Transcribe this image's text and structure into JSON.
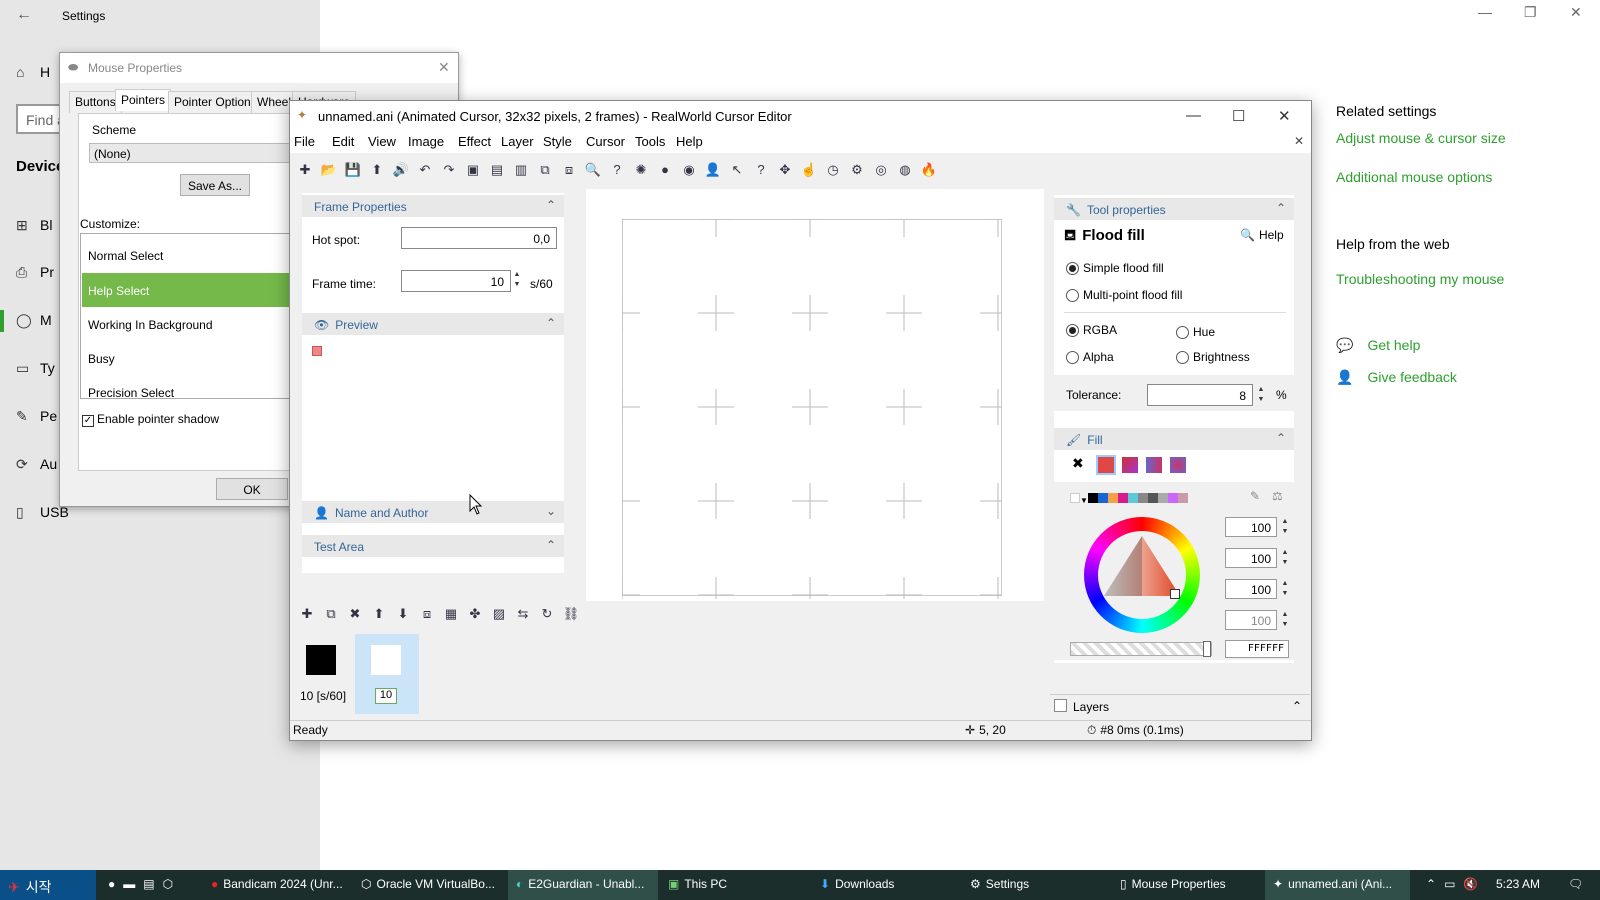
{
  "settings": {
    "title": "Settings",
    "search_placeholder": "Find a setting",
    "section": "Devices",
    "nav": [
      {
        "label": "Bluetooth & other devices",
        "short": "Bl"
      },
      {
        "label": "Printers & scanners",
        "short": "Pr"
      },
      {
        "label": "Mouse",
        "short": "M"
      },
      {
        "label": "Typing",
        "short": "Ty"
      },
      {
        "label": "Pen & Windows Ink",
        "short": "Pe"
      },
      {
        "label": "AutoPlay",
        "short": "Au"
      },
      {
        "label": "USB",
        "short": "USB"
      }
    ],
    "home_short": "H",
    "related_title": "Related settings",
    "link_size": "Adjust mouse & cursor size",
    "link_additional": "Additional mouse options",
    "help_title": "Help from the web",
    "link_trouble": "Troubleshooting my mouse",
    "get_help": "Get help",
    "give_feedback": "Give feedback"
  },
  "mouse_props": {
    "title": "Mouse Properties",
    "tabs": [
      "Buttons",
      "Pointers",
      "Pointer Options",
      "Wheel",
      "Hardware"
    ],
    "scheme_label": "Scheme",
    "scheme_value": "(None)",
    "save_as": "Save As...",
    "customize_label": "Customize:",
    "cursors": [
      "Normal Select",
      "Help Select",
      "Working In Background",
      "Busy",
      "Precision Select"
    ],
    "shadow_label": "Enable pointer shadow",
    "ok": "OK"
  },
  "editor": {
    "title": "unnamed.ani (Animated Cursor, 32x32 pixels, 2 frames) - RealWorld Cursor Editor",
    "menu": [
      "File",
      "Edit",
      "View",
      "Image",
      "Effect",
      "Layer",
      "Style",
      "Cursor",
      "Tools",
      "Help"
    ],
    "frame_properties": "Frame Properties",
    "hotspot_label": "Hot spot:",
    "hotspot_value": "0,0",
    "frametime_label": "Frame time:",
    "frametime_value": "10",
    "frametime_unit": "s/60",
    "preview": "Preview",
    "name_author": "Name and Author",
    "test_area": "Test Area",
    "frame1_label": "10 [s/60]",
    "frame2_label": "10",
    "status": "Ready",
    "coords": "5, 20",
    "timing": "#8 0ms (0.1ms)"
  },
  "tool_props": {
    "header": "Tool properties",
    "tool_name": "Flood fill",
    "help": "Help",
    "simple": "Simple flood fill",
    "multi": "Multi-point flood fill",
    "rgba": "RGBA",
    "hue": "Hue",
    "alpha": "Alpha",
    "brightness": "Brightness",
    "tolerance_label": "Tolerance:",
    "tolerance_value": "8",
    "tolerance_unit": "%",
    "fill": "Fill",
    "values": [
      "100",
      "100",
      "100",
      "100"
    ],
    "hex": "FFFFFF",
    "layers": "Layers"
  },
  "taskbar": {
    "start": "시작",
    "items": [
      "Bandicam 2024 (Unr...",
      "Oracle VM VirtualBo...",
      "E2Guardian - Unabl...",
      "This PC",
      "Downloads",
      "Settings",
      "Mouse Properties",
      "unnamed.ani (Ani..."
    ],
    "time": "5:23 AM"
  },
  "colors": {
    "accent_green": "#2ea02e",
    "selection_green": "#74b94a",
    "taskbar": "#1c2e2b"
  }
}
